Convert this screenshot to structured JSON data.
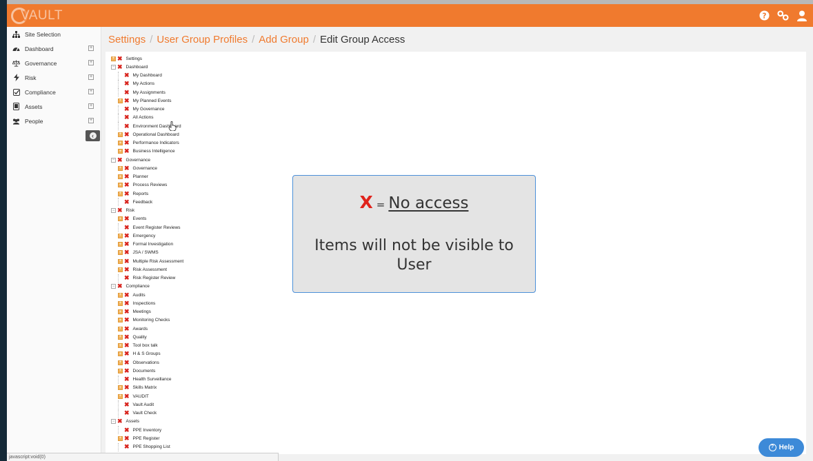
{
  "app": {
    "logo_text": "VAULT"
  },
  "topbar": {
    "icons": [
      "help-circle-icon",
      "link-icon",
      "user-icon"
    ]
  },
  "sidebar": {
    "items": [
      {
        "label": "Site Selection",
        "icon": "sitemap-icon",
        "expandable": false
      },
      {
        "label": "Dashboard",
        "icon": "dashboard-icon",
        "expandable": true
      },
      {
        "label": "Governance",
        "icon": "scales-icon",
        "expandable": true
      },
      {
        "label": "Risk",
        "icon": "bolt-icon",
        "expandable": true
      },
      {
        "label": "Compliance",
        "icon": "checkbox-icon",
        "expandable": true
      },
      {
        "label": "Assets",
        "icon": "tablet-icon",
        "expandable": true
      },
      {
        "label": "People",
        "icon": "users-icon",
        "expandable": true
      }
    ]
  },
  "breadcrumb": [
    "Settings",
    "User Group Profiles",
    "Add Group",
    "Edit Group Access"
  ],
  "tree": [
    {
      "label": "Settings",
      "level": 0,
      "toggle": "plus"
    },
    {
      "label": "Dashboard",
      "level": 0,
      "toggle": "minus"
    },
    {
      "label": "My Dashboard",
      "level": 1,
      "toggle": "none"
    },
    {
      "label": "My Actions",
      "level": 1,
      "toggle": "none"
    },
    {
      "label": "My Assignments",
      "level": 1,
      "toggle": "none"
    },
    {
      "label": "My Planned Events",
      "level": 1,
      "toggle": "plus"
    },
    {
      "label": "My Governance",
      "level": 1,
      "toggle": "none"
    },
    {
      "label": "All Actions",
      "level": 1,
      "toggle": "none"
    },
    {
      "label": "Environment Dashboard",
      "level": 1,
      "toggle": "none"
    },
    {
      "label": "Operational Dashboard",
      "level": 1,
      "toggle": "plus"
    },
    {
      "label": "Performance Indicators",
      "level": 1,
      "toggle": "plus"
    },
    {
      "label": "Business Intelligence",
      "level": 1,
      "toggle": "plus"
    },
    {
      "label": "Governance",
      "level": 0,
      "toggle": "minus"
    },
    {
      "label": "Governance",
      "level": 1,
      "toggle": "plus"
    },
    {
      "label": "Planner",
      "level": 1,
      "toggle": "plus"
    },
    {
      "label": "Process Reviews",
      "level": 1,
      "toggle": "plus"
    },
    {
      "label": "Reports",
      "level": 1,
      "toggle": "plus"
    },
    {
      "label": "Feedback",
      "level": 1,
      "toggle": "none"
    },
    {
      "label": "Risk",
      "level": 0,
      "toggle": "minus"
    },
    {
      "label": "Events",
      "level": 1,
      "toggle": "plus"
    },
    {
      "label": "Event Register Reviews",
      "level": 1,
      "toggle": "none"
    },
    {
      "label": "Emergency",
      "level": 1,
      "toggle": "plus"
    },
    {
      "label": "Formal Investigation",
      "level": 1,
      "toggle": "plus"
    },
    {
      "label": "JSA / SWMS",
      "level": 1,
      "toggle": "plus"
    },
    {
      "label": "Multiple Risk Assessment",
      "level": 1,
      "toggle": "plus"
    },
    {
      "label": "Risk Assessment",
      "level": 1,
      "toggle": "plus"
    },
    {
      "label": "Risk Register Review",
      "level": 1,
      "toggle": "none"
    },
    {
      "label": "Compliance",
      "level": 0,
      "toggle": "minus"
    },
    {
      "label": "Audits",
      "level": 1,
      "toggle": "plus"
    },
    {
      "label": "Inspections",
      "level": 1,
      "toggle": "plus"
    },
    {
      "label": "Meetings",
      "level": 1,
      "toggle": "plus"
    },
    {
      "label": "Monitoring Checks",
      "level": 1,
      "toggle": "plus"
    },
    {
      "label": "Awards",
      "level": 1,
      "toggle": "plus"
    },
    {
      "label": "Quality",
      "level": 1,
      "toggle": "plus"
    },
    {
      "label": "Tool box talk",
      "level": 1,
      "toggle": "plus"
    },
    {
      "label": "H & S Groups",
      "level": 1,
      "toggle": "plus"
    },
    {
      "label": "Observations",
      "level": 1,
      "toggle": "plus"
    },
    {
      "label": "Documents",
      "level": 1,
      "toggle": "plus"
    },
    {
      "label": "Health Surveillance",
      "level": 1,
      "toggle": "none"
    },
    {
      "label": "Skills Matrix",
      "level": 1,
      "toggle": "plus"
    },
    {
      "label": "VAUDIT",
      "level": 1,
      "toggle": "plus"
    },
    {
      "label": "Vault Audit",
      "level": 1,
      "toggle": "none"
    },
    {
      "label": "Vault Check",
      "level": 1,
      "toggle": "none"
    },
    {
      "label": "Assets",
      "level": 0,
      "toggle": "minus"
    },
    {
      "label": "PPE Inventory",
      "level": 1,
      "toggle": "none"
    },
    {
      "label": "PPE Register",
      "level": 1,
      "toggle": "plus"
    },
    {
      "label": "PPE Shopping List",
      "level": 1,
      "toggle": "none"
    }
  ],
  "legend": {
    "symbol": "X",
    "equals": "=",
    "meaning": "No access",
    "description": "Items will not be visible to User",
    "accent_color": "#e0231c"
  },
  "status_bar": {
    "text": "javascript:void(0)"
  },
  "help": {
    "label": "Help"
  },
  "colors": {
    "brand": "#f07a2e",
    "help_button": "#3d8ad8",
    "deny": "#d8231c"
  }
}
